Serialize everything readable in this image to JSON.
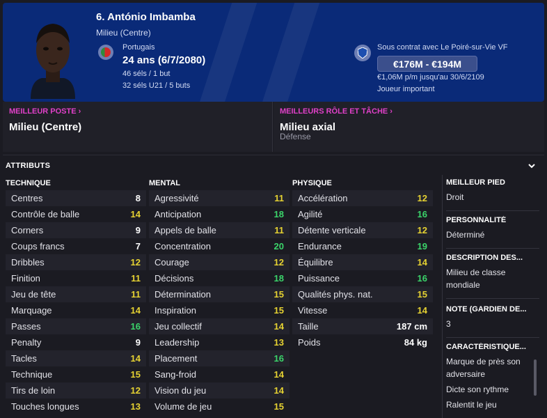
{
  "header": {
    "name": "6. António Imbamba",
    "position": "Milieu (Centre)",
    "nation": "Portugais",
    "age": "24 ans (6/7/2080)",
    "caps": "46 séls / 1 but",
    "u21_caps": "32 séls U21 / 5 buts",
    "contract": "Sous contrat avec Le Poiré-sur-Vie VF",
    "value": "€176M - €194M",
    "wage": "€1,06M p/m jusqu'au 30/6/2109",
    "status": "Joueur important"
  },
  "best_position": {
    "label": "MEILLEUR POSTE",
    "value": "Milieu (Centre)"
  },
  "best_role": {
    "label": "MEILLEURS RÔLE ET TÂCHE",
    "value": "Milieu axial",
    "duty": "Défense"
  },
  "attributes": {
    "title": "ATTRIBUTS",
    "technical": {
      "header": "TECHNIQUE",
      "rows": [
        {
          "label": "Centres",
          "value": "8",
          "tier": "white"
        },
        {
          "label": "Contrôle de balle",
          "value": "14",
          "tier": "yellow"
        },
        {
          "label": "Corners",
          "value": "9",
          "tier": "white"
        },
        {
          "label": "Coups francs",
          "value": "7",
          "tier": "white"
        },
        {
          "label": "Dribbles",
          "value": "12",
          "tier": "yellow"
        },
        {
          "label": "Finition",
          "value": "11",
          "tier": "yellow"
        },
        {
          "label": "Jeu de tête",
          "value": "11",
          "tier": "yellow"
        },
        {
          "label": "Marquage",
          "value": "14",
          "tier": "yellow"
        },
        {
          "label": "Passes",
          "value": "16",
          "tier": "green"
        },
        {
          "label": "Penalty",
          "value": "9",
          "tier": "white"
        },
        {
          "label": "Tacles",
          "value": "14",
          "tier": "yellow"
        },
        {
          "label": "Technique",
          "value": "15",
          "tier": "yellow"
        },
        {
          "label": "Tirs de loin",
          "value": "12",
          "tier": "yellow"
        },
        {
          "label": "Touches longues",
          "value": "13",
          "tier": "yellow"
        }
      ]
    },
    "mental": {
      "header": "MENTAL",
      "rows": [
        {
          "label": "Agressivité",
          "value": "11",
          "tier": "yellow"
        },
        {
          "label": "Anticipation",
          "value": "18",
          "tier": "green"
        },
        {
          "label": "Appels de balle",
          "value": "11",
          "tier": "yellow"
        },
        {
          "label": "Concentration",
          "value": "20",
          "tier": "green"
        },
        {
          "label": "Courage",
          "value": "12",
          "tier": "yellow"
        },
        {
          "label": "Décisions",
          "value": "18",
          "tier": "green"
        },
        {
          "label": "Détermination",
          "value": "15",
          "tier": "yellow"
        },
        {
          "label": "Inspiration",
          "value": "15",
          "tier": "yellow"
        },
        {
          "label": "Jeu collectif",
          "value": "14",
          "tier": "yellow"
        },
        {
          "label": "Leadership",
          "value": "13",
          "tier": "yellow"
        },
        {
          "label": "Placement",
          "value": "16",
          "tier": "green"
        },
        {
          "label": "Sang-froid",
          "value": "14",
          "tier": "yellow"
        },
        {
          "label": "Vision du jeu",
          "value": "14",
          "tier": "yellow"
        },
        {
          "label": "Volume de jeu",
          "value": "15",
          "tier": "yellow"
        }
      ]
    },
    "physical": {
      "header": "PHYSIQUE",
      "rows": [
        {
          "label": "Accélération",
          "value": "12",
          "tier": "yellow"
        },
        {
          "label": "Agilité",
          "value": "16",
          "tier": "green"
        },
        {
          "label": "Détente verticale",
          "value": "12",
          "tier": "yellow"
        },
        {
          "label": "Endurance",
          "value": "19",
          "tier": "green"
        },
        {
          "label": "Équilibre",
          "value": "14",
          "tier": "yellow"
        },
        {
          "label": "Puissance",
          "value": "16",
          "tier": "green"
        },
        {
          "label": "Qualités phys. nat.",
          "value": "15",
          "tier": "yellow"
        },
        {
          "label": "Vitesse",
          "value": "14",
          "tier": "yellow"
        },
        {
          "label": "Taille",
          "value": "187 cm",
          "tier": "white"
        },
        {
          "label": "Poids",
          "value": "84 kg",
          "tier": "white"
        }
      ]
    }
  },
  "info": {
    "foot_label": "MEILLEUR PIED",
    "foot_value": "Droit",
    "personality_label": "PERSONNALITÉ",
    "personality_value": "Déterminé",
    "media_label": "DESCRIPTION DES...",
    "media_value": "Milieu de classe mondiale",
    "gk_label": "NOTE (GARDIEN DE...",
    "gk_value": "3",
    "traits_label": "CARACTÉRISTIQUE...",
    "traits": [
      "Marque de près son adversaire",
      "Dicte son rythme",
      "Ralentit le jeu"
    ]
  },
  "colors": {
    "header_bg": "#0a2a78",
    "link": "#e040c8",
    "yellow": "#e6d232",
    "green": "#3bd46a"
  },
  "icons": {
    "nation_flag": "portugal-flag-icon",
    "club_badge": "club-badge-icon",
    "collapse": "chevron-down-icon"
  }
}
